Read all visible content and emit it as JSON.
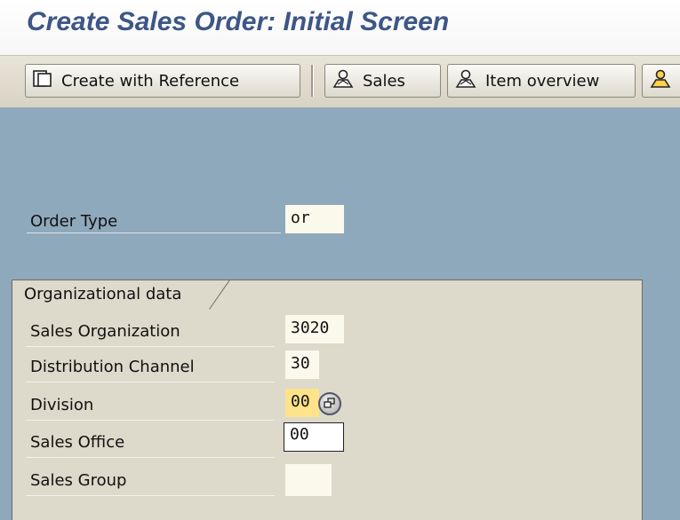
{
  "window": {
    "title": "Create Sales Order: Initial Screen"
  },
  "toolbar": {
    "create_ref_label": "Create with Reference",
    "sales_label": "Sales",
    "item_overview_label": "Item overview"
  },
  "header": {
    "order_type_label": "Order Type",
    "order_type_value": "or"
  },
  "org_data": {
    "title": "Organizational data",
    "sales_org_label": "Sales Organization",
    "sales_org_value": "3020",
    "dist_channel_label": "Distribution Channel",
    "dist_channel_value": "30",
    "division_label": "Division",
    "division_value": "00",
    "sales_office_label": "Sales Office",
    "sales_office_value": "00",
    "sales_group_label": "Sales Group",
    "sales_group_value": ""
  },
  "colors": {
    "title": "#3d5686",
    "screen_bg": "#8fa9bc",
    "group_bg": "#ddd9cb",
    "focus_field": "#ffe38a"
  },
  "icons": [
    "copy-icon",
    "person-icon",
    "person-icon",
    "person-icon",
    "matchcode-icon"
  ]
}
